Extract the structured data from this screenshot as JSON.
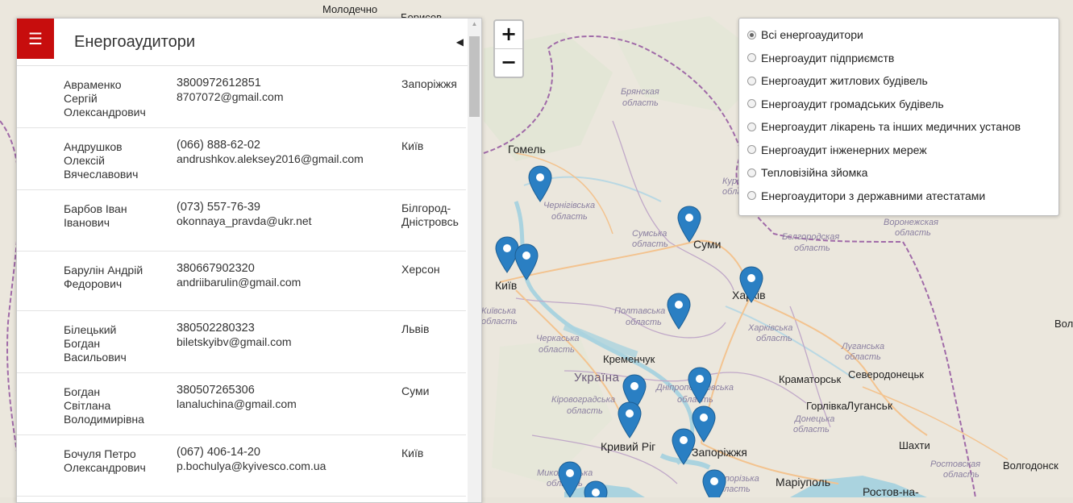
{
  "panel": {
    "title": "Енергоаудитори",
    "rows": [
      {
        "name": [
          "Авраменко",
          "Сергій",
          "Олександрович"
        ],
        "phone": "3800972612851",
        "email": "8707072@gmail.com",
        "city": [
          "Запоріжжя"
        ]
      },
      {
        "name": [
          "Андрушков",
          "Олексій",
          "Вячеславович"
        ],
        "phone": "(066) 888-62-02",
        "email": "andrushkov.aleksey2016@gmail.com",
        "city": [
          "Київ"
        ]
      },
      {
        "name": [
          "Барбов Іван",
          "Іванович"
        ],
        "phone": "(073) 557-76-39",
        "email": "okonnaya_pravda@ukr.net",
        "city": [
          "Білгород-",
          "Дністровсь"
        ]
      },
      {
        "name": [
          "Барулін Андрій",
          "Федорович"
        ],
        "phone": "380667902320",
        "email": "andriibarulin@gmail.com",
        "city": [
          "Херсон"
        ]
      },
      {
        "name": [
          "Білецький",
          "Богдан",
          "Васильович"
        ],
        "phone": "380502280323",
        "email": "biletskyibv@gmail.com",
        "city": [
          "Львів"
        ]
      },
      {
        "name": [
          "Богдан",
          "Світлана",
          "Володимирівна"
        ],
        "phone": "380507265306",
        "email": "lanaluchina@gmail.com",
        "city": [
          "Суми"
        ]
      },
      {
        "name": [
          "Бочуля Петро",
          "Олександрович"
        ],
        "phone": "(067) 406-14-20",
        "email": "p.bochulya@kyivesco.com.ua",
        "city": [
          "Київ"
        ]
      }
    ]
  },
  "zoom": {
    "in": "+",
    "out": "−"
  },
  "filters": {
    "selected": 0,
    "options": [
      "Всі енергоаудитори",
      "Енергоаудит підприємств",
      "Енергоаудит житлових будівель",
      "Енергоаудит громадських будівель",
      "Енергоаудит лікарень та інших медичних установ",
      "Енергоаудит інженерних мереж",
      "Тепловізійна зйомка",
      "Енергоаудитори з державними атестатами"
    ]
  },
  "map": {
    "labels": [
      {
        "text": "Молодечно",
        "cls": "city"
      },
      {
        "text": "Борисов",
        "cls": "city"
      },
      {
        "text": "Гомель",
        "cls": "city-big"
      },
      {
        "text": "Брянская",
        "cls": "region"
      },
      {
        "text": "область",
        "cls": "region"
      },
      {
        "text": "Чернігівська",
        "cls": "region"
      },
      {
        "text": "область",
        "cls": "region"
      },
      {
        "text": "Сумська",
        "cls": "region"
      },
      {
        "text": "область",
        "cls": "region"
      },
      {
        "text": "Суми",
        "cls": "city-big"
      },
      {
        "text": "Київ",
        "cls": "city-big"
      },
      {
        "text": "Київська",
        "cls": "region"
      },
      {
        "text": "область",
        "cls": "region"
      },
      {
        "text": "Полтавська",
        "cls": "region"
      },
      {
        "text": "область",
        "cls": "region"
      },
      {
        "text": "Бєлгородская",
        "cls": "region"
      },
      {
        "text": "область",
        "cls": "region"
      },
      {
        "text": "Воронежская",
        "cls": "region"
      },
      {
        "text": "область",
        "cls": "region"
      },
      {
        "text": "Харків",
        "cls": "city-big"
      },
      {
        "text": "Харківська",
        "cls": "region"
      },
      {
        "text": "область",
        "cls": "region"
      },
      {
        "text": "Черкаська",
        "cls": "region"
      },
      {
        "text": "область",
        "cls": "region"
      },
      {
        "text": "Кременчук",
        "cls": "city"
      },
      {
        "text": "Україна",
        "cls": "country"
      },
      {
        "text": "Луганська",
        "cls": "region"
      },
      {
        "text": "область",
        "cls": "region"
      },
      {
        "text": "Краматорськ",
        "cls": "city"
      },
      {
        "text": "Северодонецьк",
        "cls": "city"
      },
      {
        "text": "Кіровоградська",
        "cls": "region"
      },
      {
        "text": "область",
        "cls": "region"
      },
      {
        "text": "Дніпропетровська",
        "cls": "region"
      },
      {
        "text": "область",
        "cls": "region"
      },
      {
        "text": "Горлівка",
        "cls": "city"
      },
      {
        "text": "Луганськ",
        "cls": "city-big"
      },
      {
        "text": "Донецька",
        "cls": "region"
      },
      {
        "text": "область",
        "cls": "region"
      },
      {
        "text": "Кривий Ріг",
        "cls": "city-big"
      },
      {
        "text": "Запоріжжя",
        "cls": "city-big"
      },
      {
        "text": "Шахти",
        "cls": "city"
      },
      {
        "text": "Миколаївська",
        "cls": "region"
      },
      {
        "text": "область",
        "cls": "region"
      },
      {
        "text": "Запорізька",
        "cls": "region"
      },
      {
        "text": "область",
        "cls": "region"
      },
      {
        "text": "Маріуполь",
        "cls": "city-big"
      },
      {
        "text": "Ростов-на-",
        "cls": "city-big"
      },
      {
        "text": "Ростовская",
        "cls": "region"
      },
      {
        "text": "область",
        "cls": "region"
      },
      {
        "text": "Волгодонск",
        "cls": "city"
      },
      {
        "text": "Вол",
        "cls": "city"
      },
      {
        "text": "Курская",
        "cls": "region"
      },
      {
        "text": "область",
        "cls": "region"
      }
    ],
    "marker_color": "#2a7fc3"
  }
}
